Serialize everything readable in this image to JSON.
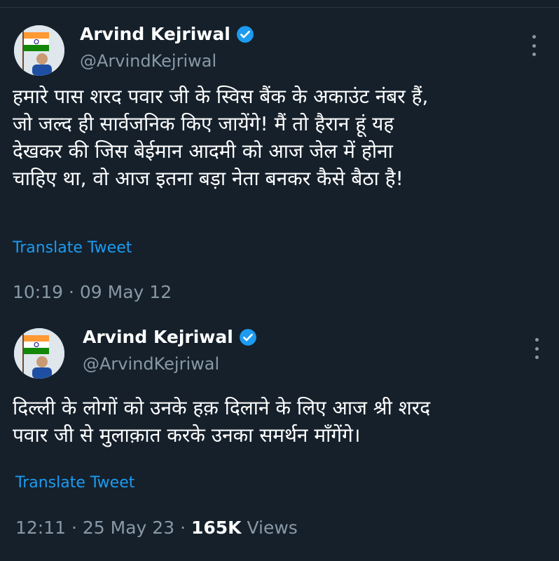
{
  "tweets": [
    {
      "author_name": "Arvind Kejriwal",
      "author_handle": "@ArvindKejriwal",
      "verified": true,
      "text_lines": [
        "हमारे पास शरद पवार जी के स्विस बैंक के अकाउंट नंबर हैं,",
        "जो जल्द ही सार्वजनिक किए जायेंगे! मैं तो हैरान हूं यह",
        "देखकर की जिस बेईमान आदमी को आज जेल में होना",
        "चाहिए था, वो आज इतना बड़ा नेता बनकर कैसे बैठा है!"
      ],
      "translate_label": "Translate Tweet",
      "time": "10:19",
      "date": "09 May 12"
    },
    {
      "author_name": "Arvind Kejriwal",
      "author_handle": "@ArvindKejriwal",
      "verified": true,
      "text_lines": [
        "दिल्ली के लोगों को उनके हक़ दिलाने के लिए आज श्री शरद",
        "पवार जी से मुलाक़ात करके उनका समर्थन माँगेंगे।"
      ],
      "translate_label": "Translate Tweet",
      "time": "12:11",
      "date": "25 May 23",
      "views_count": "165K",
      "views_label": "Views"
    }
  ],
  "separator": "·",
  "colors": {
    "background": "#15202b",
    "accent": "#1d9bf0",
    "secondary_text": "#8899a6",
    "primary_text": "#ffffff"
  },
  "icons": {
    "verified": "verified-badge-icon",
    "more": "more-options-icon"
  }
}
